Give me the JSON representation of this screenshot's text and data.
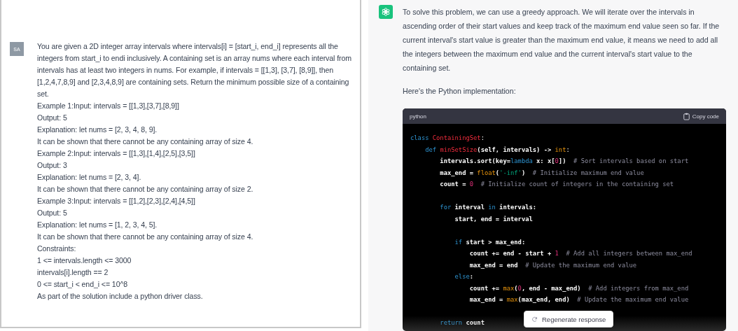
{
  "user_message": {
    "avatar": "SA",
    "lines": [
      "You are given a 2D integer array intervals where intervals[i] = [start_i, end_i] represents all the integers from start_i to endi inclusively. A containing set is an array nums where each interval from intervals has at least two integers in nums. For example, if intervals = [[1,3], [3,7], [8,9]], then [1,2,4,7,8,9] and [2,3,4,8,9] are containing sets. Return the minimum possible size of a containing set.",
      "Example 1:Input: intervals = [[1,3],[3,7],[8,9]]",
      "Output: 5",
      "Explanation: let nums = [2, 3, 4, 8, 9].",
      "It can be shown that there cannot be any containing array of size 4.",
      "Example 2:Input: intervals = [[1,3],[1,4],[2,5],[3,5]]",
      "Output: 3",
      "Explanation: let nums = [2, 3, 4].",
      "It can be shown that there cannot be any containing array of size 2.",
      "Example 3:Input: intervals = [[1,2],[2,3],[2,4],[4,5]]",
      "Output: 5",
      "Explanation: let nums = [1, 2, 3, 4, 5].",
      "It can be shown that there cannot be any containing array of size 4.",
      "Constraints:",
      "1 <= intervals.length <= 3000",
      "intervals[i].length == 2",
      "0 <= start_i < end_i <= 10^8",
      "As part of the solution include a python driver class."
    ]
  },
  "assistant_message": {
    "paragraphs": [
      "To solve this problem, we can use a greedy approach. We will iterate over the intervals in ascending order of their start values and keep track of the maximum end value seen so far. If the current interval's start value is greater than the maximum end value, it means we need to add all the integers between the maximum end value and the current interval's start value to the containing set.",
      "Here's the Python implementation:"
    ],
    "code_block": {
      "language": "python",
      "copy_label": "Copy code",
      "blocks": [
        [
          [
            {
              "kind": "keyword",
              "text": "class "
            },
            {
              "kind": "title",
              "text": "ContainingSet"
            },
            {
              "kind": "plain",
              "text": ":"
            }
          ],
          [
            {
              "kind": "keyword",
              "text": "    def "
            },
            {
              "kind": "title",
              "text": "minSetSize"
            },
            {
              "kind": "bold",
              "text": "(self, intervals) -> "
            },
            {
              "kind": "builtin",
              "text": "int"
            },
            {
              "kind": "plain",
              "text": ":"
            }
          ],
          [
            {
              "kind": "bold",
              "text": "        intervals.sort(key="
            },
            {
              "kind": "keyword",
              "text": "lambda"
            },
            {
              "kind": "bold",
              "text": " x: x["
            },
            {
              "kind": "number",
              "text": "0"
            },
            {
              "kind": "bold",
              "text": "])"
            },
            {
              "kind": "comment",
              "text": "  # Sort intervals based on start"
            }
          ],
          [
            {
              "kind": "bold",
              "text": "        max_end = "
            },
            {
              "kind": "builtin",
              "text": "float"
            },
            {
              "kind": "bold",
              "text": "("
            },
            {
              "kind": "string",
              "text": "'-inf'"
            },
            {
              "kind": "bold",
              "text": ")"
            },
            {
              "kind": "comment",
              "text": "  # Initialize maximum end value"
            }
          ],
          [
            {
              "kind": "bold",
              "text": "        count = "
            },
            {
              "kind": "number",
              "text": "0"
            },
            {
              "kind": "comment",
              "text": "  # Initialize count of integers in the containing set"
            }
          ]
        ],
        [
          [
            {
              "kind": "keyword",
              "text": "        for"
            },
            {
              "kind": "bold",
              "text": " interval "
            },
            {
              "kind": "keyword",
              "text": "in"
            },
            {
              "kind": "bold",
              "text": " intervals:"
            }
          ],
          [
            {
              "kind": "bold",
              "text": "            start, end = interval"
            }
          ]
        ],
        [
          [
            {
              "kind": "keyword",
              "text": "            if"
            },
            {
              "kind": "bold",
              "text": " start > max_end:"
            }
          ],
          [
            {
              "kind": "bold",
              "text": "                count += end - start + "
            },
            {
              "kind": "number",
              "text": "1"
            },
            {
              "kind": "comment",
              "text": "  # Add all integers between max_end"
            }
          ],
          [
            {
              "kind": "bold",
              "text": "                max_end = end"
            },
            {
              "kind": "comment",
              "text": "  # Update the maximum end value"
            }
          ],
          [
            {
              "kind": "keyword",
              "text": "            else"
            },
            {
              "kind": "bold",
              "text": ":"
            }
          ],
          [
            {
              "kind": "bold",
              "text": "                count += "
            },
            {
              "kind": "builtin",
              "text": "max"
            },
            {
              "kind": "bold",
              "text": "("
            },
            {
              "kind": "number",
              "text": "0"
            },
            {
              "kind": "bold",
              "text": ", end - max_end)"
            },
            {
              "kind": "comment",
              "text": "  # Add integers from max_end"
            }
          ],
          [
            {
              "kind": "bold",
              "text": "                max_end = "
            },
            {
              "kind": "builtin",
              "text": "max"
            },
            {
              "kind": "bold",
              "text": "(max_end, end)"
            },
            {
              "kind": "comment",
              "text": "  # Update the maximum end value"
            }
          ]
        ],
        [
          [
            {
              "kind": "keyword",
              "text": "        return"
            },
            {
              "kind": "bold",
              "text": " count"
            }
          ]
        ]
      ]
    }
  },
  "regenerate_button": {
    "label": "Regenerate response"
  }
}
